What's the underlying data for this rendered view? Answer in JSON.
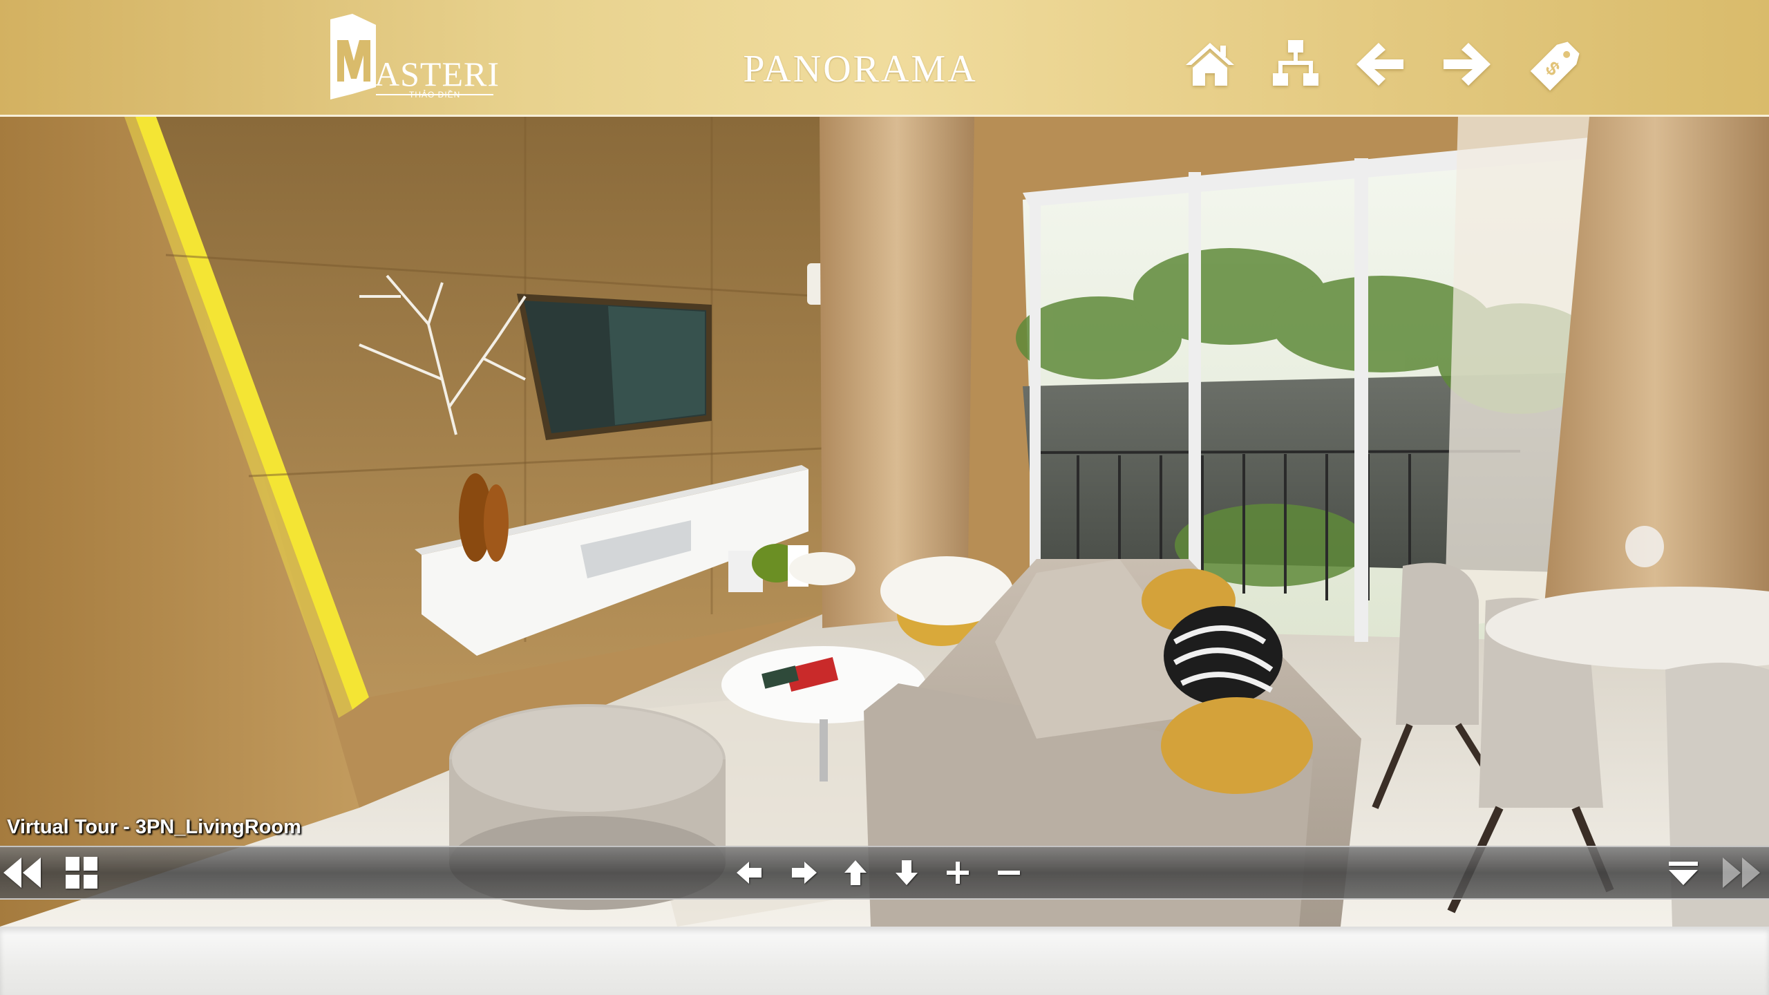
{
  "header": {
    "logo_text": "ASTERI",
    "logo_initial": "M",
    "logo_subtext": "THẢO ĐIỀN",
    "title": "PANORAMA",
    "buttons": [
      {
        "name": "home-button",
        "icon": "home-icon"
      },
      {
        "name": "sitemap-button",
        "icon": "sitemap-icon"
      },
      {
        "name": "back-button",
        "icon": "arrow-left-icon"
      },
      {
        "name": "forward-button",
        "icon": "arrow-right-icon"
      },
      {
        "name": "price-tag-button",
        "icon": "price-tag-icon"
      }
    ]
  },
  "viewer": {
    "caption": "Virtual Tour - 3PN_LivingRoom",
    "scene": "living room panorama"
  },
  "toolbar": {
    "left": [
      {
        "name": "hide-controls-button",
        "icon": "double-chevron-left-icon"
      },
      {
        "name": "thumbnails-button",
        "icon": "grid-icon"
      }
    ],
    "center": [
      {
        "name": "pan-left-button",
        "icon": "arrow-left-icon"
      },
      {
        "name": "pan-right-button",
        "icon": "arrow-right-icon"
      },
      {
        "name": "pan-up-button",
        "icon": "arrow-up-icon"
      },
      {
        "name": "pan-down-button",
        "icon": "arrow-down-icon"
      },
      {
        "name": "zoom-in-button",
        "icon": "plus-icon"
      },
      {
        "name": "zoom-out-button",
        "icon": "minus-icon"
      }
    ],
    "right": [
      {
        "name": "dropdown-menu-button",
        "icon": "triangle-down-icon"
      },
      {
        "name": "next-panorama-button",
        "icon": "double-chevron-right-icon"
      }
    ]
  },
  "colors": {
    "header_gold": "#e8d28e",
    "toolbar_gray": "#5a5a5a",
    "accent_yellow": "#f4e534"
  }
}
